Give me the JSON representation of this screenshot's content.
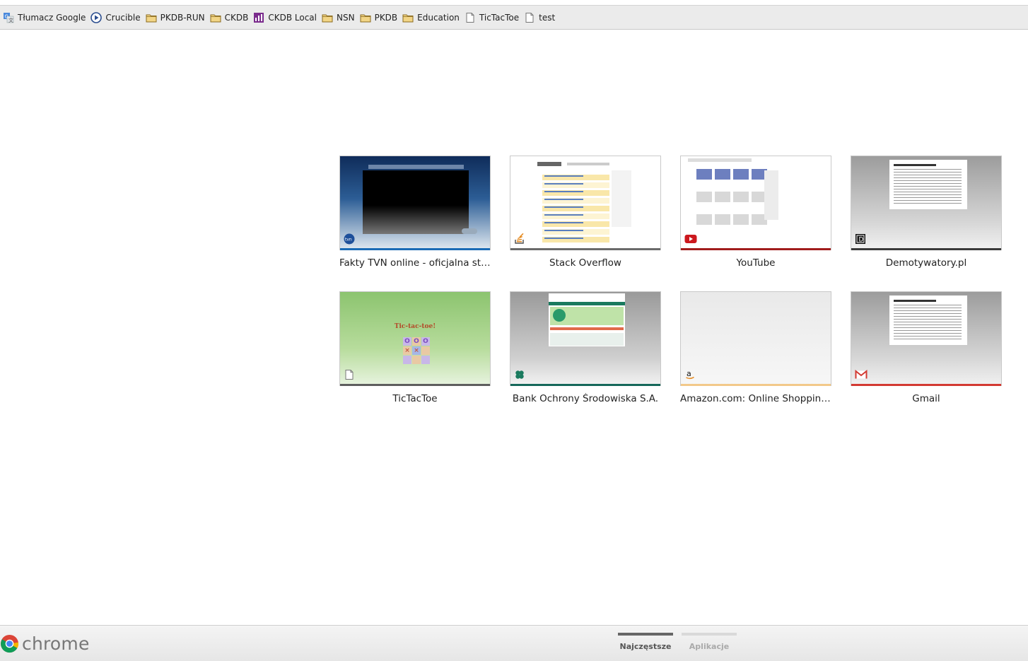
{
  "bookmarks": [
    {
      "label": "Tłumacz Google",
      "icon": "google-translate-icon"
    },
    {
      "label": "Crucible",
      "icon": "crucible-icon"
    },
    {
      "label": "PKDB-RUN",
      "icon": "folder-icon"
    },
    {
      "label": "CKDB",
      "icon": "folder-icon"
    },
    {
      "label": "CKDB Local",
      "icon": "ckdb-local-icon"
    },
    {
      "label": "NSN",
      "icon": "folder-icon"
    },
    {
      "label": "PKDB",
      "icon": "folder-icon"
    },
    {
      "label": "Education",
      "icon": "folder-icon"
    },
    {
      "label": "TicTacToe",
      "icon": "page-icon"
    },
    {
      "label": "test",
      "icon": "page-icon"
    }
  ],
  "tiles": [
    {
      "title": "Fakty TVN online - oficjalna stron...",
      "icon": "tvn24-icon",
      "bar_color": "#1a6bb5"
    },
    {
      "title": "Stack Overflow",
      "icon": "stackoverflow-icon",
      "bar_color": "#6a6a6a"
    },
    {
      "title": "YouTube",
      "icon": "youtube-icon",
      "bar_color": "#a11c1c"
    },
    {
      "title": "Demotywatory.pl",
      "icon": "demotywatory-icon",
      "bar_color": "#3a3a3a"
    },
    {
      "title": "TicTacToe",
      "icon": "page-icon",
      "bar_color": "#5e5e5e"
    },
    {
      "title": "Bank Ochrony Środowiska S.A.",
      "icon": "bos-clover-icon",
      "bar_color": "#16685a"
    },
    {
      "title": "Amazon.com: Online Shopping f...",
      "icon": "amazon-icon",
      "bar_color": "#f2c98a"
    },
    {
      "title": "Gmail",
      "icon": "gmail-icon",
      "bar_color": "#d33a32"
    }
  ],
  "tictactoe_thumb": {
    "heading": "Tic-tac-toe!",
    "cells": [
      "O",
      "O",
      "O",
      "×",
      "×",
      "",
      "",
      "",
      ""
    ]
  },
  "footer": {
    "logo_text": "chrome",
    "nav": [
      {
        "label": "Najczęstsze",
        "active": true
      },
      {
        "label": "Aplikacje",
        "active": false
      }
    ]
  },
  "colors": {
    "nav_active": "#666666",
    "nav_inactive": "#d9d9d9"
  }
}
